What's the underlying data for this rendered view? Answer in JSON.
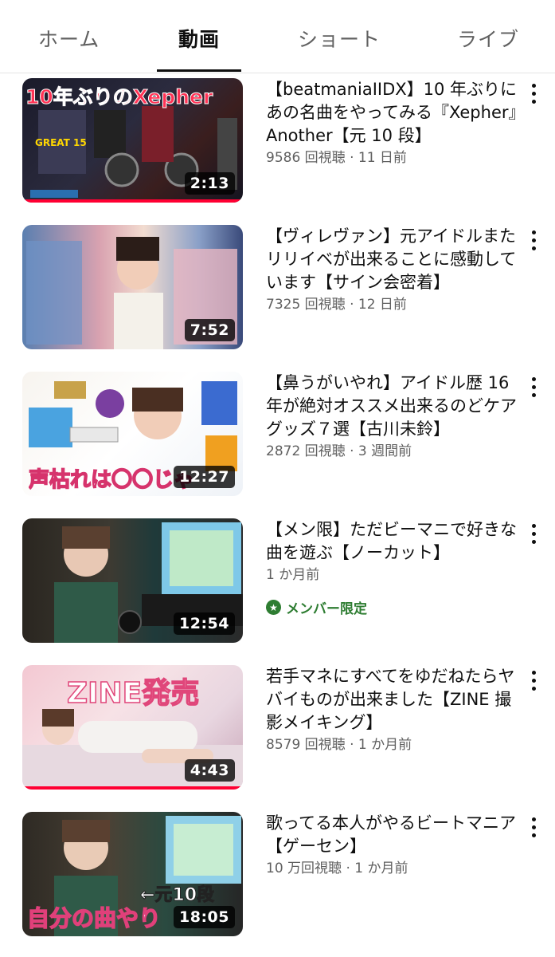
{
  "tabs": [
    {
      "label": "ホーム",
      "active": false
    },
    {
      "label": "動画",
      "active": true
    },
    {
      "label": "ショート",
      "active": false
    },
    {
      "label": "ライブ",
      "active": false
    }
  ],
  "videos": [
    {
      "title": "【beatmaniaIIDX】10 年ぶりにあの名曲をやってみる『Xepher』Another【元 10 段】",
      "meta": "9586 回視聴 · 11 日前",
      "duration": "2:13",
      "thumb_text": "10年ぶりのXepher",
      "thumb_subtext": "GREAT 15"
    },
    {
      "title": "【ヴィレヴァン】元アイドルまたリリイベが出来ることに感動しています【サイン会密着】",
      "meta": "7325 回視聴 · 12 日前",
      "duration": "7:52"
    },
    {
      "title": "【鼻うがいやれ】アイドル歴 16 年が絶対オススメ出来るのどケアグッズ７選【古川未鈴】",
      "meta": "2872 回視聴 · 3 週間前",
      "duration": "12:27",
      "thumb_text": "声枯れは〇〇じゃ"
    },
    {
      "title": "【メン限】ただビーマニで好きな曲を遊ぶ【ノーカット】",
      "meta": "1 か月前",
      "duration": "12:54",
      "member_label": "メンバー限定",
      "member_icon": "star-icon"
    },
    {
      "title": "若手マネにすべてをゆだねたらヤバイものが出来ました【ZINE 撮影メイキング】",
      "meta": "8579 回視聴 · 1 か月前",
      "duration": "4:43",
      "thumb_text": "ZINE発売"
    },
    {
      "title": "歌ってる本人がやるビートマニア【ゲーセン】",
      "meta": "10 万回視聴 · 1 か月前",
      "duration": "18:05",
      "thumb_text": "自分の曲やり",
      "thumb_subtext": "←元10段"
    }
  ],
  "colors": {
    "watched_bar": "#ff0033",
    "member_green": "#2e7d32",
    "text_primary": "#0f0f0f",
    "text_secondary": "#606060"
  }
}
